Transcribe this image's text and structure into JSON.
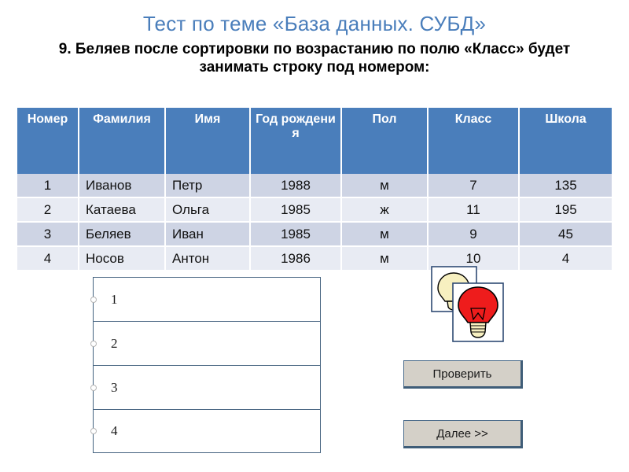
{
  "slide": {
    "title": "Тест по теме «База данных. СУБД»",
    "question": "9. Беляев после сортировки по возрастанию по полю «Класс» будет занимать строку под номером:",
    "title_color": "#4a7ebb",
    "header_color": "#4a7ebb",
    "row_color_odd": "#ced4e4",
    "row_color_even": "#e8ebf3"
  },
  "table": {
    "headers": [
      "Номер",
      "Фамилия",
      "Имя",
      "Год рождения",
      "Пол",
      "Класс",
      "Школа"
    ],
    "rows": [
      {
        "nomer": "1",
        "familiya": "Иванов",
        "imya": "Петр",
        "god": "1988",
        "pol": "м",
        "klass": "7",
        "shkola": "135"
      },
      {
        "nomer": "2",
        "familiya": "Катаева",
        "imya": "Ольга",
        "god": "1985",
        "pol": "ж",
        "klass": "11",
        "shkola": "195"
      },
      {
        "nomer": "3",
        "familiya": "Беляев",
        "imya": "Иван",
        "god": "1985",
        "pol": "м",
        "klass": "9",
        "shkola": "45"
      },
      {
        "nomer": "4",
        "familiya": "Носов",
        "imya": "Антон",
        "god": "1986",
        "pol": "м",
        "klass": "10",
        "shkola": "4"
      }
    ]
  },
  "options": [
    {
      "label": "1",
      "selected": false
    },
    {
      "label": "2",
      "selected": false
    },
    {
      "label": "3",
      "selected": false
    },
    {
      "label": "4",
      "selected": false
    }
  ],
  "buttons": {
    "check": "Проверить",
    "next": "Далее >>"
  },
  "artwork": {
    "name": "two-lightbulbs-picture",
    "back_bulb_color": "#f7f0c0",
    "front_bulb_color": "#ee1c1c",
    "frame_border_color": "#2e4a73"
  }
}
